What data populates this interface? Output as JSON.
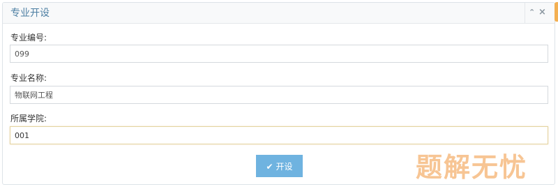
{
  "panel": {
    "title": "专业开设",
    "collapse_icon": "chevron-up-icon",
    "close_icon": "close-icon",
    "collapse_glyph": "⌃",
    "close_glyph": "×"
  },
  "form": {
    "major_code": {
      "label": "专业编号:",
      "value": "099"
    },
    "major_name": {
      "label": "专业名称:",
      "value": "物联网工程"
    },
    "college": {
      "label": "所属学院:",
      "value": "001"
    }
  },
  "actions": {
    "submit_label": "开设",
    "submit_icon": "check-icon",
    "submit_glyph": "✔"
  },
  "watermark": {
    "text": "题解无忧"
  },
  "colors": {
    "title": "#4d7fa3",
    "button": "#6fb3e0",
    "focus_border": "#e4d3a0",
    "corner_tab": "#f3b052"
  }
}
